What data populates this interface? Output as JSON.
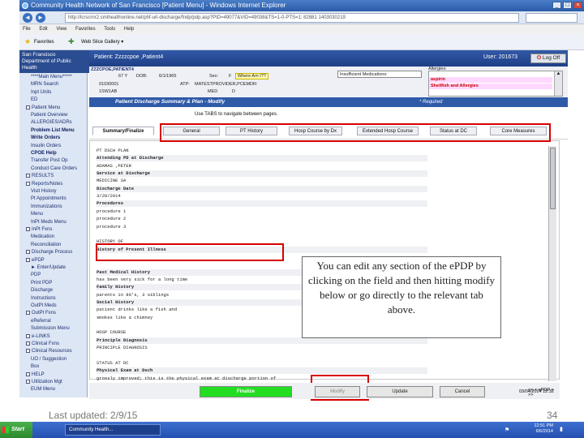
{
  "browser": {
    "title": "Community Health Network of San Francisco [Patient Menu] - Windows Internet Explorer",
    "url": "http://lcrscrnr2.smthealthonline.net/phf-url-discharge/fndp/pdp.asp?PID=49077&VID=49038&TS=1-0-PTS=1; 82881 1403030219",
    "menu": [
      "File",
      "Edit",
      "View",
      "Favorites",
      "Tools",
      "Help"
    ],
    "favorites_label": "Favorites",
    "web_slice_label": "Web Slice Gallery ▾"
  },
  "app": {
    "org_line1": "San Francisco",
    "org_line2": "Department of Public Health",
    "patient_label": "Patient: Zzzzcpoe ,Patient4",
    "user_label": "User: 201673",
    "logoff_label": "Log Off",
    "info": {
      "name": "ZZZCPOE,PATIENT4",
      "age": "67 Y",
      "dob_label": "DOB:",
      "dob": "6/1/1965",
      "sex_label": "Sex:",
      "sex": "F",
      "where": "Where Am I??",
      "mrn": "01030001",
      "atp_label": "ATP:",
      "attending": "MATESTPROVIDER,PCEMDR:",
      "loc": "1SW1AB",
      "med_label": "MED",
      "med": "D",
      "insufficient": "Insufficient Medications:",
      "allergies_label": "Allergies:",
      "allergy1": "aspirin",
      "allergy2": "Shellfish and Allergies"
    }
  },
  "sidebar": {
    "items": [
      {
        "label": "****Main Menu*****",
        "bold": false,
        "box": false
      },
      {
        "label": "MRN Search",
        "bold": false,
        "box": false
      },
      {
        "label": "Inpt Units",
        "bold": false,
        "box": false
      },
      {
        "label": "ED",
        "bold": false,
        "box": false
      },
      {
        "label": "Patient Menu",
        "bold": false,
        "box": true
      },
      {
        "label": "Patient Overview",
        "bold": false,
        "box": false
      },
      {
        "label": "ALLERGIES/ADRs",
        "bold": false,
        "box": false
      },
      {
        "label": "Problem List Menu",
        "bold": true,
        "box": false
      },
      {
        "label": "Write Orders",
        "bold": true,
        "box": false
      },
      {
        "label": "Insulin Orders",
        "bold": false,
        "box": false
      },
      {
        "label": "CPOE Help",
        "bold": true,
        "box": false
      },
      {
        "label": "Transfer Post Op",
        "bold": false,
        "box": false
      },
      {
        "label": "Conduct Care Orders",
        "bold": false,
        "box": false
      },
      {
        "label": "RESULTS",
        "bold": false,
        "box": true
      },
      {
        "label": "Reports/Notes",
        "bold": false,
        "box": true
      },
      {
        "label": "Visit History",
        "bold": false,
        "box": false
      },
      {
        "label": "Pt Appointments",
        "bold": false,
        "box": false
      },
      {
        "label": "Immunizations",
        "bold": false,
        "box": false
      },
      {
        "label": "Menu",
        "bold": false,
        "box": false
      },
      {
        "label": "InPt Meds Menu",
        "bold": false,
        "box": false
      },
      {
        "label": "InPt Fxns",
        "bold": false,
        "box": true
      },
      {
        "label": "Medication",
        "bold": false,
        "box": false
      },
      {
        "label": "Reconciliation",
        "bold": false,
        "box": false
      },
      {
        "label": "Discharge Process",
        "bold": false,
        "box": true
      },
      {
        "label": "ePDP",
        "bold": false,
        "box": true
      },
      {
        "label": "► Enter/Update",
        "bold": false,
        "box": false
      },
      {
        "label": "PDP",
        "bold": false,
        "box": false
      },
      {
        "label": "Print PDP",
        "bold": false,
        "box": false
      },
      {
        "label": "Discharge",
        "bold": false,
        "box": false
      },
      {
        "label": "Instructions",
        "bold": false,
        "box": false
      },
      {
        "label": "OutPt Meds",
        "bold": false,
        "box": false
      },
      {
        "label": "OutPt Fxns",
        "bold": false,
        "box": true
      },
      {
        "label": "eReferral",
        "bold": false,
        "box": false
      },
      {
        "label": "Submission Menu",
        "bold": false,
        "box": false
      },
      {
        "label": "e-LINKS",
        "bold": false,
        "box": true
      },
      {
        "label": "Clinical Fxns",
        "bold": false,
        "box": true
      },
      {
        "label": "Clinical Resources",
        "bold": false,
        "box": true
      },
      {
        "label": "UO / Suggestion",
        "bold": false,
        "box": false
      },
      {
        "label": "Box",
        "bold": false,
        "box": false
      },
      {
        "label": "HELP",
        "bold": false,
        "box": true
      },
      {
        "label": "Utilization Mgt",
        "bold": false,
        "box": true
      },
      {
        "label": "EUM Menu",
        "bold": false,
        "box": false
      }
    ]
  },
  "form": {
    "title": "Patient Discharge Summary & Plan - Modify",
    "required": "* Required",
    "tab_hint": "Use TABS to navigate between pages.",
    "tabs": [
      "Summary/Finalize",
      "General",
      "PT History",
      "Hosp Course by Dx",
      "Extended Hosp Course",
      "Status at DC",
      "Core Measures"
    ]
  },
  "document": {
    "lines": [
      {
        "text": "PT DSCH PLAN",
        "shade": false,
        "bold": false
      },
      {
        "text": "  Attending PD at Discharge",
        "shade": true,
        "bold": true
      },
      {
        "text": "    ADAMAS ,PETER",
        "shade": false,
        "bold": false
      },
      {
        "text": "  Service at Discharge",
        "shade": true,
        "bold": true
      },
      {
        "text": "    MEDICINE SA",
        "shade": false,
        "bold": false
      },
      {
        "text": "  Discharge Date",
        "shade": true,
        "bold": true
      },
      {
        "text": "    3/28/2014",
        "shade": false,
        "bold": false
      },
      {
        "text": "  Procedures",
        "shade": true,
        "bold": true
      },
      {
        "text": "    procedure 1",
        "shade": false,
        "bold": false
      },
      {
        "text": "    procedure 2",
        "shade": false,
        "bold": false
      },
      {
        "text": "    procedure 3",
        "shade": false,
        "bold": false
      },
      {
        "text": "",
        "shade": false,
        "bold": false
      },
      {
        "text": "HISTORY OF",
        "shade": false,
        "bold": false
      },
      {
        "text": "  History of Present Illness",
        "shade": true,
        "bold": true
      },
      {
        "text": "",
        "shade": false,
        "bold": false
      },
      {
        "text": "",
        "shade": false,
        "bold": false
      },
      {
        "text": "  Past Medical History",
        "shade": true,
        "bold": true
      },
      {
        "text": "    has been very sick for a long time",
        "shade": false,
        "bold": false
      },
      {
        "text": "  Family History",
        "shade": true,
        "bold": true
      },
      {
        "text": "    parents in 80's, 3 siblings",
        "shade": false,
        "bold": false
      },
      {
        "text": "  Social History",
        "shade": true,
        "bold": true
      },
      {
        "text": "    patient drinks like a fish and",
        "shade": false,
        "bold": false
      },
      {
        "text": "    smokes like a chimney",
        "shade": false,
        "bold": false
      },
      {
        "text": "",
        "shade": false,
        "bold": false
      },
      {
        "text": "HOSP COURSE",
        "shade": false,
        "bold": false
      },
      {
        "text": "  Principle Diagnosis",
        "shade": true,
        "bold": true
      },
      {
        "text": "    PRINCIPLE DIAGNOSIS",
        "shade": false,
        "bold": false
      },
      {
        "text": "",
        "shade": false,
        "bold": false
      },
      {
        "text": "STATUS AT DC",
        "shade": false,
        "bold": false
      },
      {
        "text": "  Physical Exam at Dsch",
        "shade": true,
        "bold": true
      },
      {
        "text": "    grossly improved; this is the physical exam at discharge portion of",
        "shade": false,
        "bold": false
      }
    ]
  },
  "callout": "You can edit any section of the ePDP by clicking on the field and then hitting modify below or go directly to the relevant tab above.",
  "buttons": {
    "finalize": "Finalize",
    "modify": "Modify",
    "update": "Update",
    "cancel": "Cancel",
    "pager": "<< < ePDP  > >>",
    "datetime": "03/04/2014 12:32"
  },
  "footer": {
    "last_updated": "Last updated: 2/9/15",
    "page_number": "34"
  },
  "taskbar": {
    "start": "Start",
    "task": "Community Health...",
    "time": "12:51 PM",
    "date": "6/6/2014"
  },
  "colors": {
    "highlight_red": "#d60000",
    "finalize_green": "#22dd22",
    "header_blue": "#2f5aa8"
  }
}
